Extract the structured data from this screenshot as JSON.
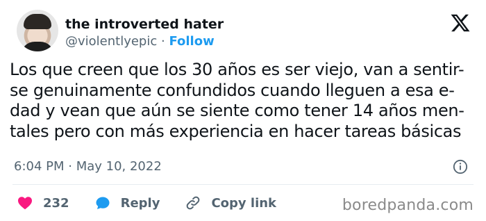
{
  "author": {
    "name": "the introverted hater",
    "handle": "@violentlyepic",
    "separator": " · ",
    "follow_label": "Follow"
  },
  "tweet": {
    "text": "Los que creen que los 30 años es ser viejo, van a sentir-\nse genuinamente confundidos cuando lleguen a esa e-\ndad y vean que aún se siente como tener 14 años men-\ntales pero con más experiencia en hacer tareas básicas",
    "timestamp": "6:04 PM · May 10, 2022"
  },
  "actions": {
    "like_count": "232",
    "reply_label": "Reply",
    "copy_link_label": "Copy link"
  },
  "watermark": "boredpanda.com",
  "icons": {
    "brand": "x-logo-icon",
    "info": "info-icon",
    "like": "heart-icon",
    "reply": "reply-bubble-icon",
    "link": "link-icon"
  },
  "colors": {
    "like": "#f91880",
    "reply": "#1d9bf0",
    "follow": "#1d9bf0",
    "muted": "#536471"
  }
}
